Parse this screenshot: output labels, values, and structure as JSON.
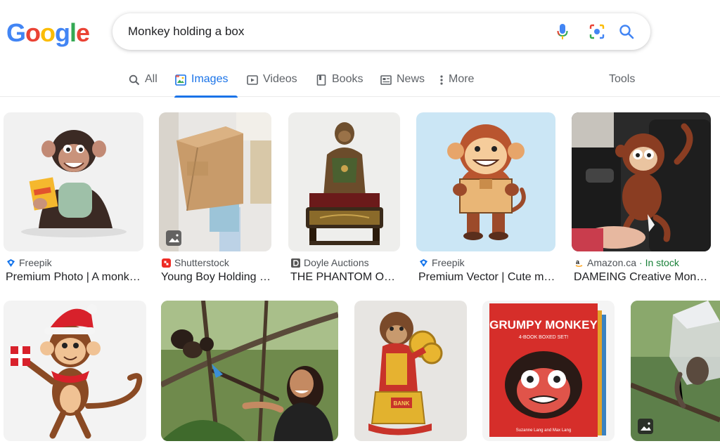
{
  "logo": {
    "letters": [
      "G",
      "o",
      "o",
      "g",
      "l",
      "e"
    ],
    "colors": [
      "#4285F4",
      "#EA4335",
      "#FBBC05",
      "#4285F4",
      "#34A853",
      "#EA4335"
    ]
  },
  "search": {
    "query": "Monkey holding a box",
    "placeholder": ""
  },
  "icons": {
    "mic": "microphone-icon",
    "lens": "camera-lens-icon",
    "search": "search-icon"
  },
  "tabs": [
    {
      "label": "All",
      "icon": "search-icon"
    },
    {
      "label": "Images",
      "icon": "image-icon",
      "active": true
    },
    {
      "label": "Videos",
      "icon": "video-play-icon"
    },
    {
      "label": "Books",
      "icon": "book-icon"
    },
    {
      "label": "News",
      "icon": "news-icon"
    },
    {
      "label": "More",
      "icon": "more-dots-icon"
    }
  ],
  "tools_label": "Tools",
  "results": [
    {
      "source": "Freepik",
      "title": "Premium Photo | A monkey holding a box",
      "title_shown": "Premium Photo | A monk…",
      "favicon": "freepik-icon"
    },
    {
      "source": "Shutterstock",
      "title": "Young Boy Holding …",
      "title_shown": "Young Boy Holding …",
      "favicon": "shutterstock-icon"
    },
    {
      "source": "Doyle Auctions",
      "title": "THE PHANTOM OF…",
      "title_shown": "THE PHANTOM OF…",
      "favicon": "doyle-icon"
    },
    {
      "source": "Freepik",
      "title": "Premium Vector | Cute m…",
      "title_shown": "Premium Vector | Cute m…",
      "favicon": "freepik-icon"
    },
    {
      "source": "Amazon.ca",
      "stock": "· In stock",
      "title": "DAMEING Creative Monk…",
      "title_shown": "DAMEING Creative Monk…",
      "favicon": "amazon-icon"
    }
  ],
  "book_cover": {
    "title": "GRUMPY MONKEY",
    "subtitle": "4-BOOK BOXED SET!",
    "authors": "Suzanne Lang and Max Lang"
  },
  "bank_label": "BANK",
  "colors": {
    "accent": "#1a73e8",
    "stock_green": "#188038"
  }
}
